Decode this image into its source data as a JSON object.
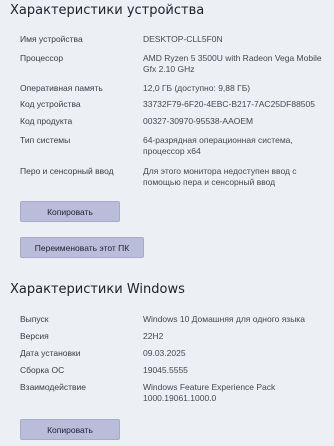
{
  "device_specs": {
    "title": "Характеристики устройства",
    "rows": [
      {
        "label": "Имя устройства",
        "value": "DESKTOP-CLL5F0N"
      },
      {
        "label": "Процессор",
        "value": "AMD Ryzen 5 3500U with Radeon Vega Mobile Gfx     2.10 GHz"
      },
      {
        "label": "Оперативная память",
        "value": "12,0 ГБ (доступно: 9,88 ГБ)"
      },
      {
        "label": "Код устройства",
        "value": "33732F79-6F20-4EBC-B217-7AC25DF88505"
      },
      {
        "label": "Код продукта",
        "value": "00327-30970-95538-AAOEM"
      },
      {
        "label": "Тип системы",
        "value": "64-разрядная операционная система, процессор x64"
      },
      {
        "label": "Перо и сенсорный ввод",
        "value": "Для этого монитора недоступен ввод с помощью пера и сенсорный ввод"
      }
    ],
    "copy_button": "Копировать",
    "rename_button": "Переименовать этот ПК"
  },
  "windows_specs": {
    "title": "Характеристики Windows",
    "rows": [
      {
        "label": "Выпуск",
        "value": "Windows 10 Домашняя для одного языка"
      },
      {
        "label": "Версия",
        "value": "22H2"
      },
      {
        "label": "Дата установки",
        "value": "09.03.2025"
      },
      {
        "label": "Сборка ОС",
        "value": "19045.5555"
      },
      {
        "label": "Взаимодействие",
        "value": "Windows Feature Experience Pack 1000.19061.1000.0"
      }
    ],
    "copy_button": "Копировать"
  }
}
